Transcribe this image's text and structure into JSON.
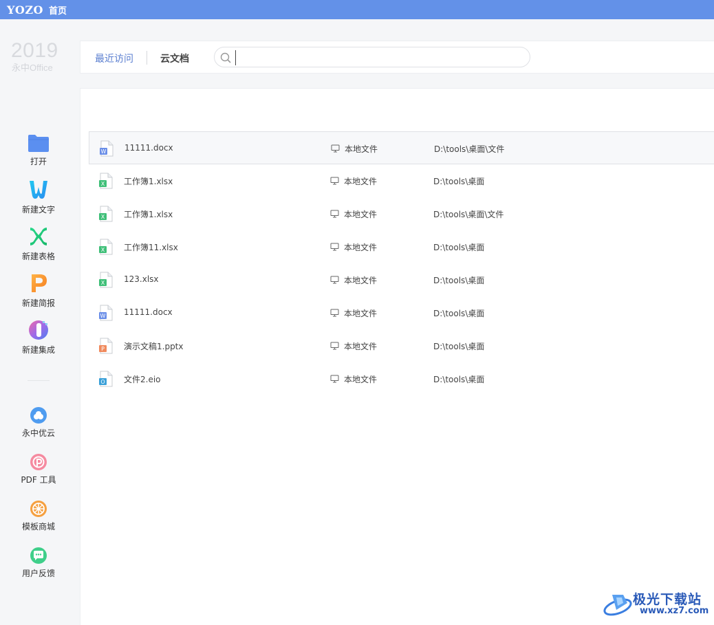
{
  "titlebar": {
    "logo": "YOZO",
    "home_tab": "首页",
    "bg_color": "#6391e8"
  },
  "brand": {
    "year": "2019",
    "name": "永中Office"
  },
  "sidebar": {
    "actions": [
      {
        "label": "打开",
        "icon": "folder-icon"
      },
      {
        "label": "新建文字",
        "icon": "word-w-icon"
      },
      {
        "label": "新建表格",
        "icon": "sheet-x-icon"
      },
      {
        "label": "新建简报",
        "icon": "slides-p-icon"
      },
      {
        "label": "新建集成",
        "icon": "integrated-icon"
      }
    ],
    "tools": [
      {
        "label": "永中优云",
        "icon": "cloud-icon"
      },
      {
        "label": "PDF 工具",
        "icon": "pdf-icon"
      },
      {
        "label": "模板商城",
        "icon": "template-store-icon"
      },
      {
        "label": "用户反馈",
        "icon": "feedback-icon"
      }
    ]
  },
  "tabs": {
    "recent": "最近访问",
    "cloud": "云文档"
  },
  "search": {
    "placeholder": "",
    "value": ""
  },
  "files": [
    {
      "name": "11111.docx",
      "type": "docx",
      "location": "本地文件",
      "path": "D:\\tools\\桌面\\文件"
    },
    {
      "name": "工作簿1.xlsx",
      "type": "xlsx",
      "location": "本地文件",
      "path": "D:\\tools\\桌面"
    },
    {
      "name": "工作簿1.xlsx",
      "type": "xlsx",
      "location": "本地文件",
      "path": "D:\\tools\\桌面\\文件"
    },
    {
      "name": "工作簿11.xlsx",
      "type": "xlsx",
      "location": "本地文件",
      "path": "D:\\tools\\桌面"
    },
    {
      "name": "123.xlsx",
      "type": "xlsx",
      "location": "本地文件",
      "path": "D:\\tools\\桌面"
    },
    {
      "name": "11111.docx",
      "type": "docx",
      "location": "本地文件",
      "path": "D:\\tools\\桌面"
    },
    {
      "name": "演示文稿1.pptx",
      "type": "pptx",
      "location": "本地文件",
      "path": "D:\\tools\\桌面"
    },
    {
      "name": "文件2.eio",
      "type": "eio",
      "location": "本地文件",
      "path": "D:\\tools\\桌面"
    }
  ],
  "file_type_colors": {
    "docx": "#6a8ee8",
    "xlsx": "#3fbf78",
    "pptx": "#f08a5d",
    "eio": "#3aa0d8"
  },
  "file_type_letters": {
    "docx": "W",
    "xlsx": "X",
    "pptx": "P",
    "eio": "O"
  },
  "watermark": {
    "text": "极光下载站",
    "url": "www.xz7.com"
  }
}
